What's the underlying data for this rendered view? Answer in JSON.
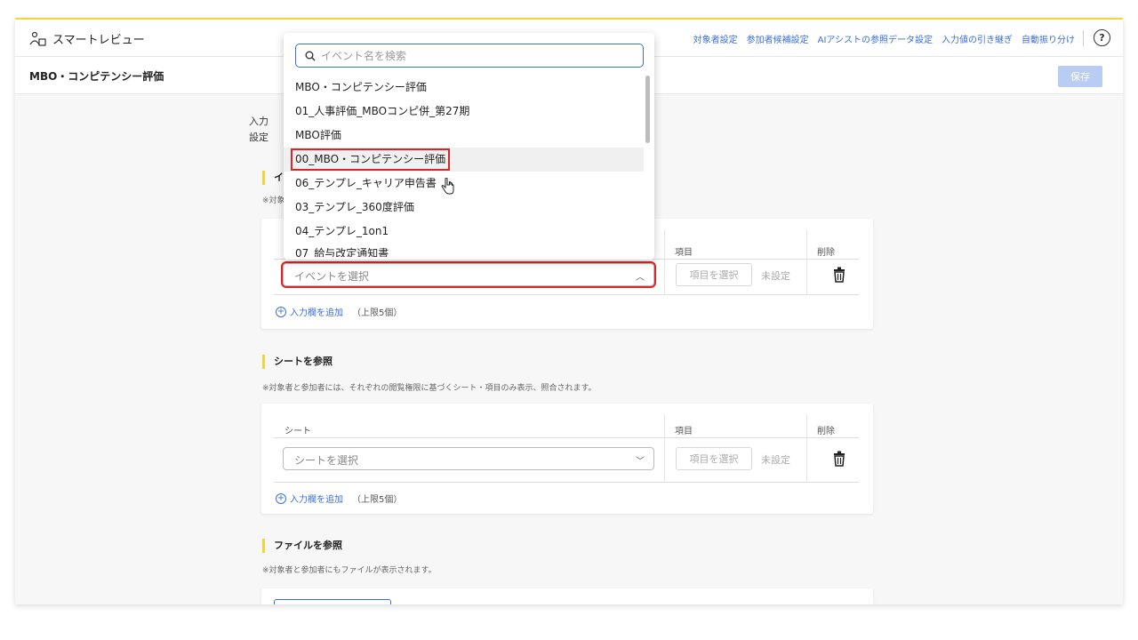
{
  "app": {
    "name": "スマートレビュー"
  },
  "topnav": [
    "対象者設定",
    "参加者候補設定",
    "AIアシストの参照データ設定",
    "入力値の引き継ぎ",
    "自動振り分け"
  ],
  "page": {
    "title": "MBO・コンピテンシー評価",
    "save_label": "保存"
  },
  "intro": {
    "line1": "入力",
    "line2": "設定"
  },
  "event_section": {
    "title_partial": "イ",
    "note_partial": "※対象",
    "col_item": "項目",
    "col_delete": "削除",
    "select_placeholder": "イベントを選択",
    "item_button": "項目を選択",
    "unset": "未設定",
    "add_label": "入力欄を追加",
    "limit": "（上限5個）"
  },
  "sheet_section": {
    "title": "シートを参照",
    "note": "※対象者と参加者には、それぞれの閲覧権限に基づくシート・項目のみ表示、照合されます。",
    "col_sheet": "シート",
    "col_item": "項目",
    "col_delete": "削除",
    "select_placeholder": "シートを選択",
    "item_button": "項目を選択",
    "unset": "未設定",
    "add_label": "入力欄を追加",
    "limit": "（上限5個）"
  },
  "file_section": {
    "title": "ファイルを参照",
    "note": "※対象者と参加者にもファイルが表示されます。"
  },
  "dropdown": {
    "search_placeholder": "イベント名を検索",
    "options": [
      "MBO・コンピテンシー評価",
      "01_人事評価_MBOコンピ併_第27期",
      "MBO評価",
      "00_MBO・コンピテンシー評価",
      "06_テンプレ_キャリア申告書",
      "03_テンプレ_360度評価",
      "04_テンプレ_1on1",
      "07_給与改定通知書"
    ],
    "hovered_index": 3
  },
  "colors": {
    "accent": "#3a6fd8",
    "highlight": "#e02424",
    "brand_yellow": "#f5d33a"
  }
}
